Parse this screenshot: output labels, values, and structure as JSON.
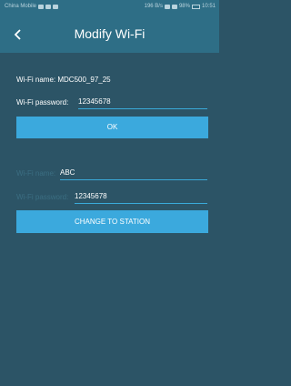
{
  "status_bar": {
    "carrier": "China Mobile",
    "right_text": "196 B/s",
    "battery": "98%",
    "time": "10:51"
  },
  "header": {
    "title": "Modify Wi-Fi",
    "back_icon": "chevron-left-icon"
  },
  "wifi_section": {
    "name_label": "Wi-Fi name:",
    "name_value": "MDC500_97_25",
    "password_label": "Wi-Fi password:",
    "password_value": "12345678",
    "ok_label": "OK"
  },
  "station_section": {
    "name_label": "Wi-Fi name:",
    "name_value": "ABC",
    "password_label": "Wi-Fi password:",
    "password_value": "12345678",
    "change_label": "CHANGE TO STATION"
  }
}
